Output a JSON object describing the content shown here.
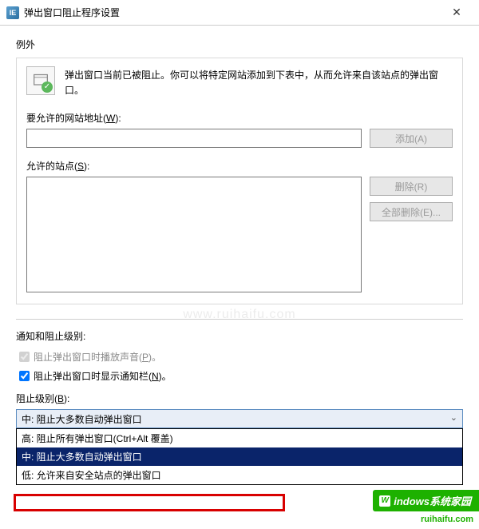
{
  "titlebar": {
    "title": "弹出窗口阻止程序设置",
    "close_glyph": "✕"
  },
  "exceptions": {
    "heading": "例外",
    "info_text": "弹出窗口当前已被阻止。你可以将特定网站添加到下表中，从而允许来自该站点的弹出窗口。",
    "address_label_pre": "要允许的网站地址(",
    "address_label_hot": "W",
    "address_label_post": "):",
    "address_value": "",
    "add_label": "添加(A)",
    "allowed_label_pre": "允许的站点(",
    "allowed_label_hot": "S",
    "allowed_label_post": "):",
    "remove_label": "删除(R)",
    "remove_all_label": "全部删除(E)..."
  },
  "notifications": {
    "heading": "通知和阻止级别:",
    "sound_label_pre": "阻止弹出窗口时播放声音(",
    "sound_label_hot": "P",
    "sound_label_post": ")。",
    "sound_checked": true,
    "sound_enabled": false,
    "bar_label_pre": "阻止弹出窗口时显示通知栏(",
    "bar_label_hot": "N",
    "bar_label_post": ")。",
    "bar_checked": true,
    "level_label_pre": "阻止级别(",
    "level_label_hot": "B",
    "level_label_post": "):",
    "selected": "中: 阻止大多数自动弹出窗口",
    "options": {
      "high": "高: 阻止所有弹出窗口(Ctrl+Alt 覆盖)",
      "medium": "中: 阻止大多数自动弹出窗口",
      "low": "低: 允许来自安全站点的弹出窗口"
    }
  },
  "watermark": "www.ruihaifu.com",
  "badge": {
    "main": "indows系统家园",
    "flag": "W",
    "sub": "ruihaifu.com"
  }
}
